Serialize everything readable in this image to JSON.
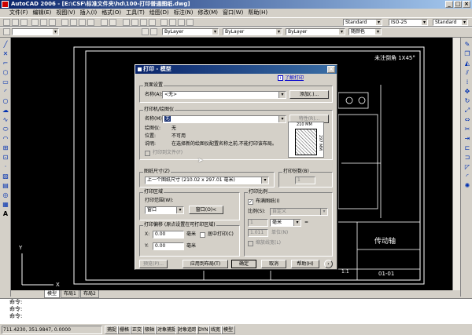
{
  "window": {
    "title": "AutoCAD 2006 - [E:\\CSF\\标准文件夹\\hd\\100-打印普通图纸.dwg]",
    "min": "_",
    "max": "□",
    "close": "×"
  },
  "menu": [
    "文件(F)",
    "编辑(E)",
    "视图(V)",
    "插入(I)",
    "格式(O)",
    "工具(T)",
    "绘图(D)",
    "标注(N)",
    "修改(M)",
    "窗口(W)",
    "帮助(H)"
  ],
  "toolbar": {
    "text_style": "Standard",
    "dim_style": "ISO-25",
    "table_style": "Standard",
    "color": "ByLayer",
    "linetype": "ByLayer",
    "lineweight": "ByLayer",
    "plotstyle": "随颜色",
    "layer": ""
  },
  "tabs": [
    "模型",
    "布局1",
    "布局2"
  ],
  "command_lines": [
    "命令:",
    "命令:",
    "命令:"
  ],
  "status": {
    "coords": "711.4230, 351.9847, 0.0000",
    "buttons": [
      "捕捉",
      "栅格",
      "正交",
      "极轴",
      "对象捕捉",
      "对象追踪",
      "DYN",
      "线宽",
      "模型"
    ]
  },
  "drawing": {
    "note": "未注倒角 1X45°",
    "title_block_name": "传动轴",
    "drawing_number": "01-01",
    "scale": "1:1",
    "axis_x": "X",
    "axis_y": "Y"
  },
  "dialog": {
    "title": "打印 - 模型",
    "help_link": "了解打印",
    "page_setup": {
      "group": "页面设置",
      "name_label": "名称(A):",
      "name_value": "<无>",
      "add_button": "添加(.)..."
    },
    "printer": {
      "group": "打印机/绘图仪",
      "name_label": "名称(M):",
      "name_value": "无",
      "properties_button": "特性(R)...",
      "plotter_label": "绘图仪:",
      "plotter_value": "无",
      "where_label": "位置:",
      "where_value": "不可用",
      "desc_label": "说明:",
      "desc_value": "在选择新的绘图仪配置名称之前,不能打印该布局。",
      "plot_to_file": "打印到文件(F)",
      "paper_dims": "210 MM",
      "paper_height": "297 MM"
    },
    "paper_size": {
      "group": "图纸尺寸(Z)",
      "value": "上一个图纸尺寸 (210.02 x 297.01 毫米)"
    },
    "copies": {
      "group": "打印份数(B)",
      "value": "1"
    },
    "plot_area": {
      "group": "打印区域",
      "what_label": "打印范围(W):",
      "what_value": "窗口",
      "window_button": "窗口(O)<"
    },
    "plot_offset": {
      "group": "打印偏移 (原点设置在可打印区域)",
      "x_label": "X:",
      "x_value": "0.00",
      "y_label": "Y:",
      "y_value": "0.00",
      "unit": "毫米",
      "center_label": "居中打印(C)"
    },
    "plot_scale": {
      "group": "打印比例",
      "fit_label": "布满图纸(I)",
      "scale_label": "比例(S):",
      "scale_value": "自定义",
      "num_value": "1",
      "num_unit": "毫米",
      "den_value": "1.011",
      "den_unit": "单位(N)",
      "lw_label": "缩放线宽(L)",
      "equals": "="
    },
    "buttons": {
      "preview": "预览(P)...",
      "apply": "应用到布局(T)",
      "ok": "确定",
      "cancel": "取消",
      "help": "帮助(H)",
      "more": "›"
    }
  }
}
